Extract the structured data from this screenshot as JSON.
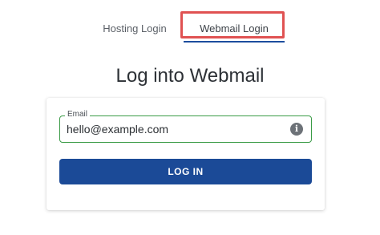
{
  "tabs": [
    {
      "label": "Hosting Login",
      "active": false
    },
    {
      "label": "Webmail Login",
      "active": true
    }
  ],
  "title": "Log into Webmail",
  "form": {
    "email": {
      "label": "Email",
      "value": "hello@example.com"
    },
    "info_icon": "info-circle-icon",
    "submit_label": "LOG IN"
  },
  "colors": {
    "accent": "#1b4a97",
    "field_border_valid": "#3a9b46",
    "highlight": "#e05252"
  }
}
